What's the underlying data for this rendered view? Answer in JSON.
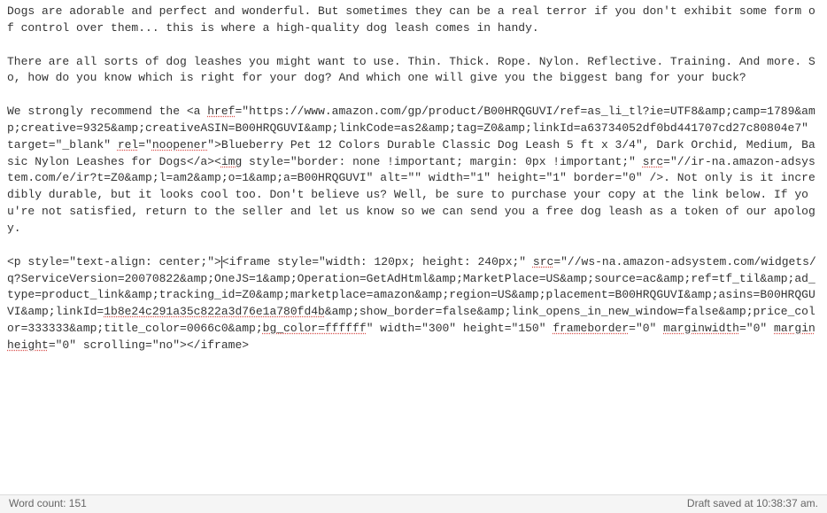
{
  "editor": {
    "p1": "Dogs are adorable and perfect and wonderful. But sometimes they can be a real terror if you don't exhibit some form of control over them... this is where a high-quality dog leash comes in handy.",
    "p2": "There are all sorts of dog leashes you might want to use. Thin. Thick. Rope. Nylon. Reflective. Training. And more. So, how do you know which is right for your dog? And which one will give you the biggest bang for your buck?",
    "p3_pre": "We strongly recommend the <a ",
    "p3_href": "href",
    "p3_eq_open": "=\"https://www.amazon.com/gp/product/B00HRQGUVI/ref=as_li_tl?ie=UTF8&amp;camp=1789&amp;creative=9325&amp;creativeASIN=B00HRQGUVI&amp;linkCode=as2&amp;tag=Z0&amp;linkId=a63734052df0bd441707cd27c80804e7\" target=\"_blank\" ",
    "p3_rel": "rel",
    "p3_after_rel": "=\"",
    "p3_noopener": "noopener",
    "p3_after_noopener": "\">Blueberry Pet 12 Colors Durable Classic Dog Leash 5 ft x 3/4\", Dark Orchid, Medium, Basic Nylon Leashes for Dogs</a><",
    "p3_img": "img",
    "p3_after_img": " style=\"border: none !important; margin: 0px !important;\" ",
    "p3_src1": "src",
    "p3_after_src1": "=\"//ir-na.amazon-adsystem.com/e/ir?t=Z0&amp;l=am2&amp;o=1&amp;a=B00HRQGUVI\" alt=\"\" width=\"1\" height=\"1\" border=\"0\" />. Not only is it incredibly durable, but it looks cool too. Don't believe us? Well, be sure to purchase your copy at the link below. If you're not satisfied, return to the seller and let us know so we can send you a free dog leash as a token of our apology.",
    "p4_open": "<p style=\"text-align: center;\">",
    "p4_iframe_open": "<iframe style=\"width: 120px; height: 240px;\" ",
    "p4_src2": "src",
    "p4_after_src2": "=\"//ws-na.amazon-adsystem.com/widgets/q?ServiceVersion=20070822&amp;OneJS=1&amp;Operation=GetAdHtml&amp;MarketPlace=US&amp;source=ac&amp;ref=tf_til&amp;ad_type=product_link&amp;tracking_id=Z0&amp;marketplace=amazon&amp;region=US&amp;placement=B00HRQGUVI&amp;asins=B00HRQGUVI&amp;linkId=",
    "p4_linkid": "1b8e24c291a35c822a3d76e1a780fd4b",
    "p4_after_linkid": "&amp;show_border=false&amp;link_opens_in_new_window=false&amp;price_color=333333&amp;title_color=0066c0&amp;",
    "p4_bgcolor": "bg_color=ffffff",
    "p4_after_bgcolor": "\" width=\"300\" height=\"150\" ",
    "p4_frameborder": "frameborder",
    "p4_fb_val": "=\"0\" ",
    "p4_marginwidth": "marginwidth",
    "p4_mw_val": "=\"0\" ",
    "p4_marginheight": "marginheight",
    "p4_mh_val": "=\"0\" scrolling=\"no\"></iframe>"
  },
  "status": {
    "word_count_label": "Word count: 151",
    "draft_saved": "Draft saved at 10:38:37 am."
  }
}
